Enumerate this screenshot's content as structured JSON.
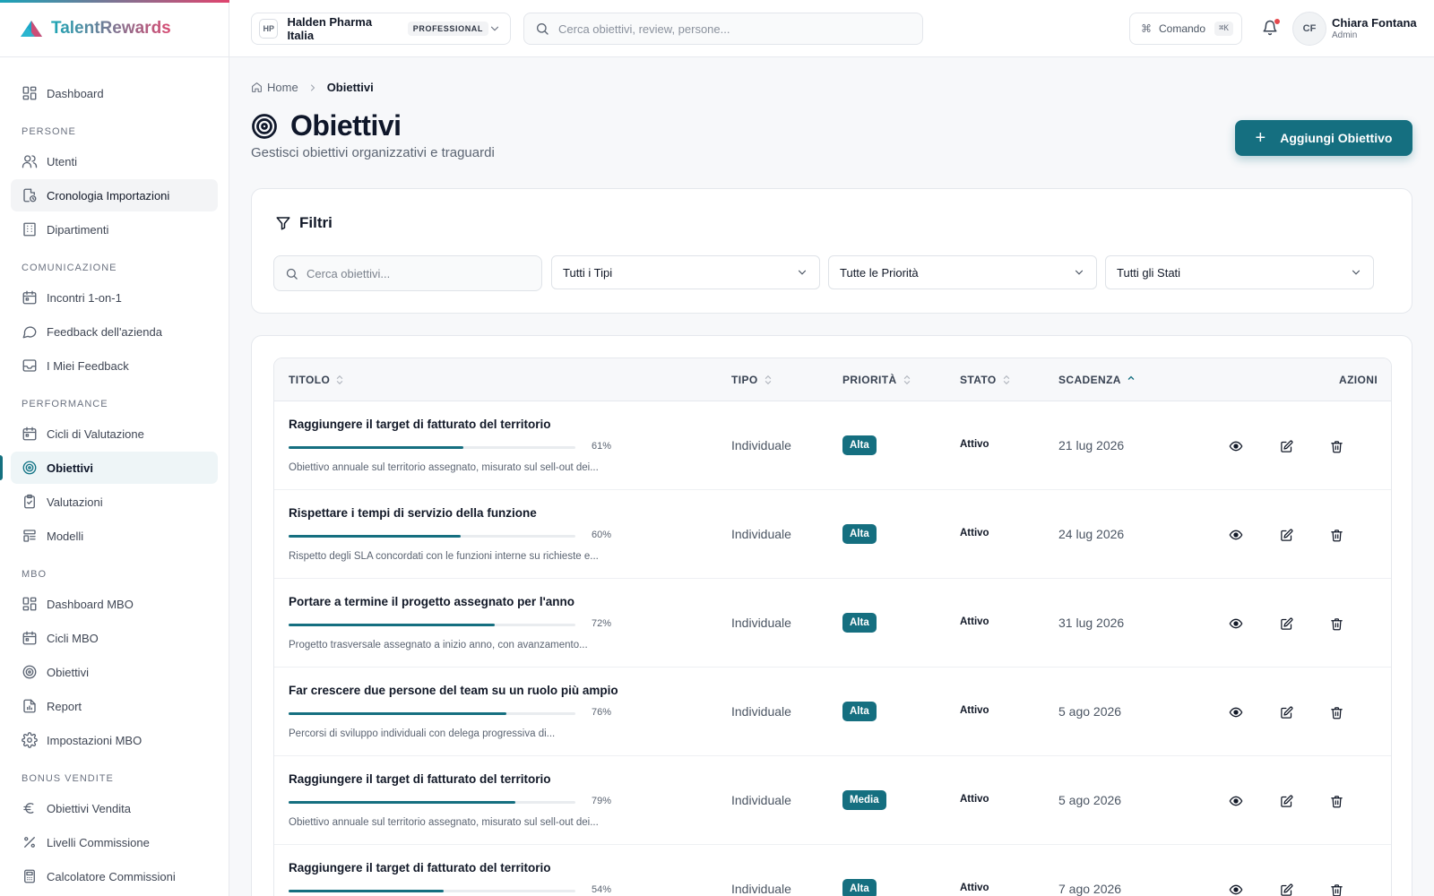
{
  "brand": {
    "name": "TalentRewards"
  },
  "sidebar": {
    "items": [
      {
        "type": "item",
        "label": "Dashboard",
        "icon": "dashboard-icon",
        "state": ""
      },
      {
        "type": "section",
        "label": "PERSONE"
      },
      {
        "type": "item",
        "label": "Utenti",
        "icon": "users-icon",
        "state": ""
      },
      {
        "type": "item",
        "label": "Cronologia Importazioni",
        "icon": "file-history-icon",
        "state": "hover"
      },
      {
        "type": "item",
        "label": "Dipartimenti",
        "icon": "building-icon",
        "state": ""
      },
      {
        "type": "section",
        "label": "COMUNICAZIONE"
      },
      {
        "type": "item",
        "label": "Incontri 1-on-1",
        "icon": "calendar-icon",
        "state": ""
      },
      {
        "type": "item",
        "label": "Feedback dell'azienda",
        "icon": "chat-bubble-icon",
        "state": ""
      },
      {
        "type": "item",
        "label": "I Miei Feedback",
        "icon": "inbox-icon",
        "state": ""
      },
      {
        "type": "section",
        "label": "PERFORMANCE"
      },
      {
        "type": "item",
        "label": "Cicli di Valutazione",
        "icon": "calendar-icon",
        "state": ""
      },
      {
        "type": "item",
        "label": "Obiettivi",
        "icon": "target-icon",
        "state": "active"
      },
      {
        "type": "item",
        "label": "Valutazioni",
        "icon": "clipboard-check-icon",
        "state": ""
      },
      {
        "type": "item",
        "label": "Modelli",
        "icon": "template-icon",
        "state": ""
      },
      {
        "type": "section",
        "label": "MBO"
      },
      {
        "type": "item",
        "label": "Dashboard MBO",
        "icon": "dashboard-icon",
        "state": ""
      },
      {
        "type": "item",
        "label": "Cicli MBO",
        "icon": "calendar-icon",
        "state": ""
      },
      {
        "type": "item",
        "label": "Obiettivi",
        "icon": "target-icon",
        "state": ""
      },
      {
        "type": "item",
        "label": "Report",
        "icon": "report-icon",
        "state": ""
      },
      {
        "type": "item",
        "label": "Impostazioni MBO",
        "icon": "gear-icon",
        "state": ""
      },
      {
        "type": "section",
        "label": "BONUS VENDITE"
      },
      {
        "type": "item",
        "label": "Obiettivi Vendita",
        "icon": "euro-icon",
        "state": ""
      },
      {
        "type": "item",
        "label": "Livelli Commissione",
        "icon": "percent-icon",
        "state": ""
      },
      {
        "type": "item",
        "label": "Calcolatore Commissioni",
        "icon": "calculator-icon",
        "state": ""
      }
    ]
  },
  "topbar": {
    "org_initials": "HP",
    "org_name": "Halden Pharma Italia",
    "org_plan": "PROFESSIONAL",
    "search_placeholder": "Cerca obiettivi, review, persone...",
    "command_label": "Comando",
    "command_shortcut": "⌘K",
    "user_initials": "CF",
    "user_name": "Chiara Fontana",
    "user_role": "Admin"
  },
  "breadcrumb": {
    "home": "Home",
    "current": "Obiettivi"
  },
  "page": {
    "title": "Obiettivi",
    "subtitle": "Gestisci obiettivi organizzativi e traguardi",
    "add_button": "Aggiungi Obiettivo"
  },
  "filters": {
    "title": "Filtri",
    "search_placeholder": "Cerca obiettivi...",
    "type_selected": "Tutti i Tipi",
    "priority_selected": "Tutte le Priorità",
    "status_selected": "Tutti gli Stati"
  },
  "table": {
    "columns": {
      "title": "TITOLO",
      "type": "TIPO",
      "priority": "PRIORITÀ",
      "status": "STATO",
      "deadline": "SCADENZA",
      "actions": "AZIONI"
    },
    "rows": [
      {
        "title": "Raggiungere il target di fatturato del territorio",
        "progress": 61,
        "progress_label": "61%",
        "description": "Obiettivo annuale sul territorio assegnato, misurato sul sell-out dei...",
        "type": "Individuale",
        "priority": "Alta",
        "status": "Attivo",
        "deadline": "21 lug 2026"
      },
      {
        "title": "Rispettare i tempi di servizio della funzione",
        "progress": 60,
        "progress_label": "60%",
        "description": "Rispetto degli SLA concordati con le funzioni interne su richieste e...",
        "type": "Individuale",
        "priority": "Alta",
        "status": "Attivo",
        "deadline": "24 lug 2026"
      },
      {
        "title": "Portare a termine il progetto assegnato per l'anno",
        "progress": 72,
        "progress_label": "72%",
        "description": "Progetto trasversale assegnato a inizio anno, con avanzamento...",
        "type": "Individuale",
        "priority": "Alta",
        "status": "Attivo",
        "deadline": "31 lug 2026"
      },
      {
        "title": "Far crescere due persone del team su un ruolo più ampio",
        "progress": 76,
        "progress_label": "76%",
        "description": "Percorsi di sviluppo individuali con delega progressiva di...",
        "type": "Individuale",
        "priority": "Alta",
        "status": "Attivo",
        "deadline": "5 ago 2026"
      },
      {
        "title": "Raggiungere il target di fatturato del territorio",
        "progress": 79,
        "progress_label": "79%",
        "description": "Obiettivo annuale sul territorio assegnato, misurato sul sell-out dei...",
        "type": "Individuale",
        "priority": "Media",
        "status": "Attivo",
        "deadline": "5 ago 2026"
      },
      {
        "title": "Raggiungere il target di fatturato del territorio",
        "progress": 54,
        "progress_label": "54%",
        "description": "",
        "type": "Individuale",
        "priority": "Alta",
        "status": "Attivo",
        "deadline": "7 ago 2026"
      }
    ]
  },
  "colors": {
    "accent": "#156f80",
    "notification": "#e5484d",
    "brand_start": "#1ba6b5",
    "brand_end": "#d94a72"
  }
}
